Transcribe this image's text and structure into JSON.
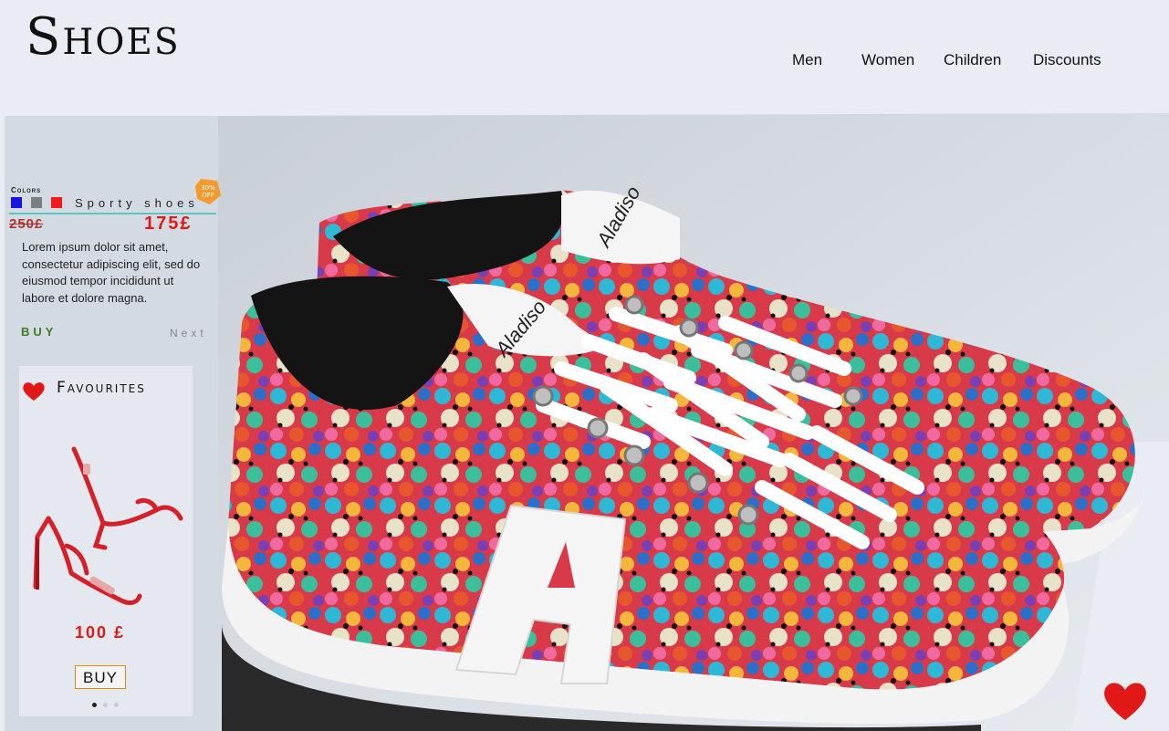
{
  "header": {
    "logo": "Shoes",
    "nav": [
      {
        "label": "Men"
      },
      {
        "label": "Women"
      },
      {
        "label": "Children"
      },
      {
        "label": "Discounts"
      }
    ]
  },
  "product": {
    "colors_label": "Colors",
    "colors": [
      "#1616e0",
      "#7d7f82",
      "#ee1c1c"
    ],
    "name": "Sporty shoes",
    "badge_line1": "30%",
    "badge_line2": "OFF",
    "old_price": "250£",
    "new_price": "175£",
    "description": "Lorem ipsum dolor sit amet, consectetur adipiscing elit, sed do eiusmod tempor incididunt ut labore et dolore magna.",
    "buy_label": "BUY",
    "next_label": "Next"
  },
  "favourites": {
    "title": "Favourites",
    "price": "100 £",
    "buy_label": "BUY",
    "active_dot": 0
  },
  "hero": {
    "brand_on_tongue": "Aladiso",
    "letter_on_side": "A"
  },
  "icons": {
    "fav_heart": "heart-icon",
    "big_heart": "heart-icon",
    "badge": "discount-badge"
  }
}
